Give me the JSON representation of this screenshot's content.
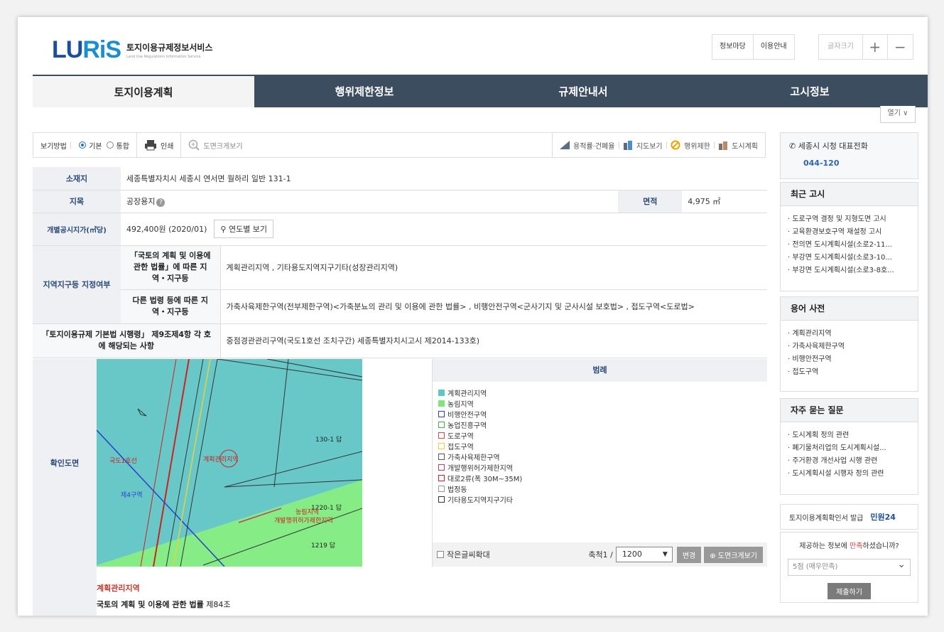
{
  "header": {
    "logo_mark_a": "LU",
    "logo_mark_b": "RiS",
    "logo_title": "토지이용규제정보서비스",
    "logo_sub": "Land Use Regulations Information Service",
    "top_links": [
      "정보마당",
      "이용안내"
    ],
    "fontsize_label": "글자크기",
    "fontsize_plus": "+",
    "fontsize_minus": "−"
  },
  "nav": {
    "tabs": [
      "토지이용계획",
      "행위제한정보",
      "규제안내서",
      "고시정보"
    ],
    "active": 0,
    "open_label": "열기 ∨"
  },
  "toolbar": {
    "view_label": "보기방법",
    "opt_basic": "기본",
    "opt_integrated": "통합",
    "print_label": "인쇄",
    "zoom_label": "도면크게보기",
    "right": [
      "용적률·건폐율",
      "지도보기",
      "행위제한",
      "도시계획"
    ]
  },
  "info": {
    "location_label": "소재지",
    "location_value": "세종특별자치시 세종시 연서면 월하리 일반 131-1",
    "jimok_label": "지목",
    "jimok_value": "공장용지",
    "area_label": "면적",
    "area_value": "4,975 ㎡",
    "price_label": "개별공시지가(㎡당)",
    "price_value": "492,400원 (2020/01)",
    "year_btn": "연도별 보기",
    "zone_label": "지역지구등 지정여부",
    "law1_label": "「국토의 계획 및 이용에 관한 법률」에 따른 지역・지구등",
    "law1_value": "계획관리지역 , 기타용도지역지구기타(성장관리지역)",
    "law2_label": "다른 법령 등에 따른 지역・지구등",
    "law2_value": "가축사육제한구역(전부제한구역)<가축분뇨의 관리 및 이용에 관한 법률> , 비행안전구역<군사기지 및 군사시설 보호법> , 접도구역<도로법>",
    "basic_label": "「토지이용규제 기본법 시행령」 제9조제4항 각 호에 해당되는 사항",
    "basic_value": "중점경관관리구역(국도1호선 조치구간) 세종특별자치시고시 제2014-133호)"
  },
  "map": {
    "label": "확인도면",
    "legend_title": "범례",
    "legend": [
      {
        "name": "계획관리지역",
        "color": "#5ac6c6",
        "fill": true
      },
      {
        "name": "농림지역",
        "color": "#7be87b",
        "fill": true
      },
      {
        "name": "비행안전구역",
        "color": "#2a3fd0",
        "fill": false
      },
      {
        "name": "농업진흥구역",
        "color": "#3cb043",
        "fill": false
      },
      {
        "name": "도로구역",
        "color": "#e04848",
        "fill": false
      },
      {
        "name": "접도구역",
        "color": "#e8d040",
        "fill": false
      },
      {
        "name": "가축사육제한구역",
        "color": "#555555",
        "fill": false
      },
      {
        "name": "개발행위허가제한지역",
        "color": "#c04060",
        "fill": false
      },
      {
        "name": "대로2류(폭 30M~35M)",
        "color": "#d02020",
        "fill": false
      },
      {
        "name": "법정동",
        "color": "#999999",
        "fill": false
      },
      {
        "name": "기타용도지역지구기타",
        "color": "#333333",
        "fill": false
      }
    ],
    "small_text_label": "작은글씨확대",
    "scale_label": "축척1 /",
    "scale_value": "1200",
    "change_btn": "변경",
    "zoom_btn": "도면크게보기",
    "labels": {
      "parcel_a": "130-1 답",
      "parcel_b": "1220-1 답",
      "parcel_c": "1219 답",
      "zone_mgmt": "계획관리지역",
      "road": "국도1호선",
      "farm": "농림지역",
      "restrict": "개발행위허가제한지역",
      "fourth": "제4구역"
    }
  },
  "desc": {
    "title": "계획관리지역",
    "law": "국토의 계획 및 이용에 관한 법률",
    "article": "제84조"
  },
  "sidebar": {
    "phone_title": "세종시 시청 대표전화",
    "phone_num": "044-120",
    "recent_title": "최근 고시",
    "recent": [
      "· 도로구역 결정 및 지형도면 고시",
      "· 교육환경보호구역 재설정 고시",
      "· 전의면 도시계획시설(소로2-11...",
      "· 부강면 도시계획시설(소로3-10...",
      "· 부강면 도시계획시설(소로3-8호..."
    ],
    "dict_title": "용어 사전",
    "dict": [
      "· 계획관리지역",
      "· 가축사육제한구역",
      "· 비행안전구역",
      "· 접도구역"
    ],
    "faq_title": "자주 묻는 질문",
    "faq": [
      "· 도시계획 정의 관련",
      "· 폐기물처리업의 도시계획시설...",
      "· 주거환경 개선사업 시행 관련",
      "· 도시계획시설 시행자 정의 관련"
    ],
    "issue_label": "토지이용계획확인서 발급",
    "minwon": "민원24",
    "survey_q_a": "제공하는 정보에 ",
    "survey_q_hl": "만족",
    "survey_q_b": "하셨습니까?",
    "survey_sel": "5점 (매우만족)",
    "survey_btn": "제출하기"
  }
}
